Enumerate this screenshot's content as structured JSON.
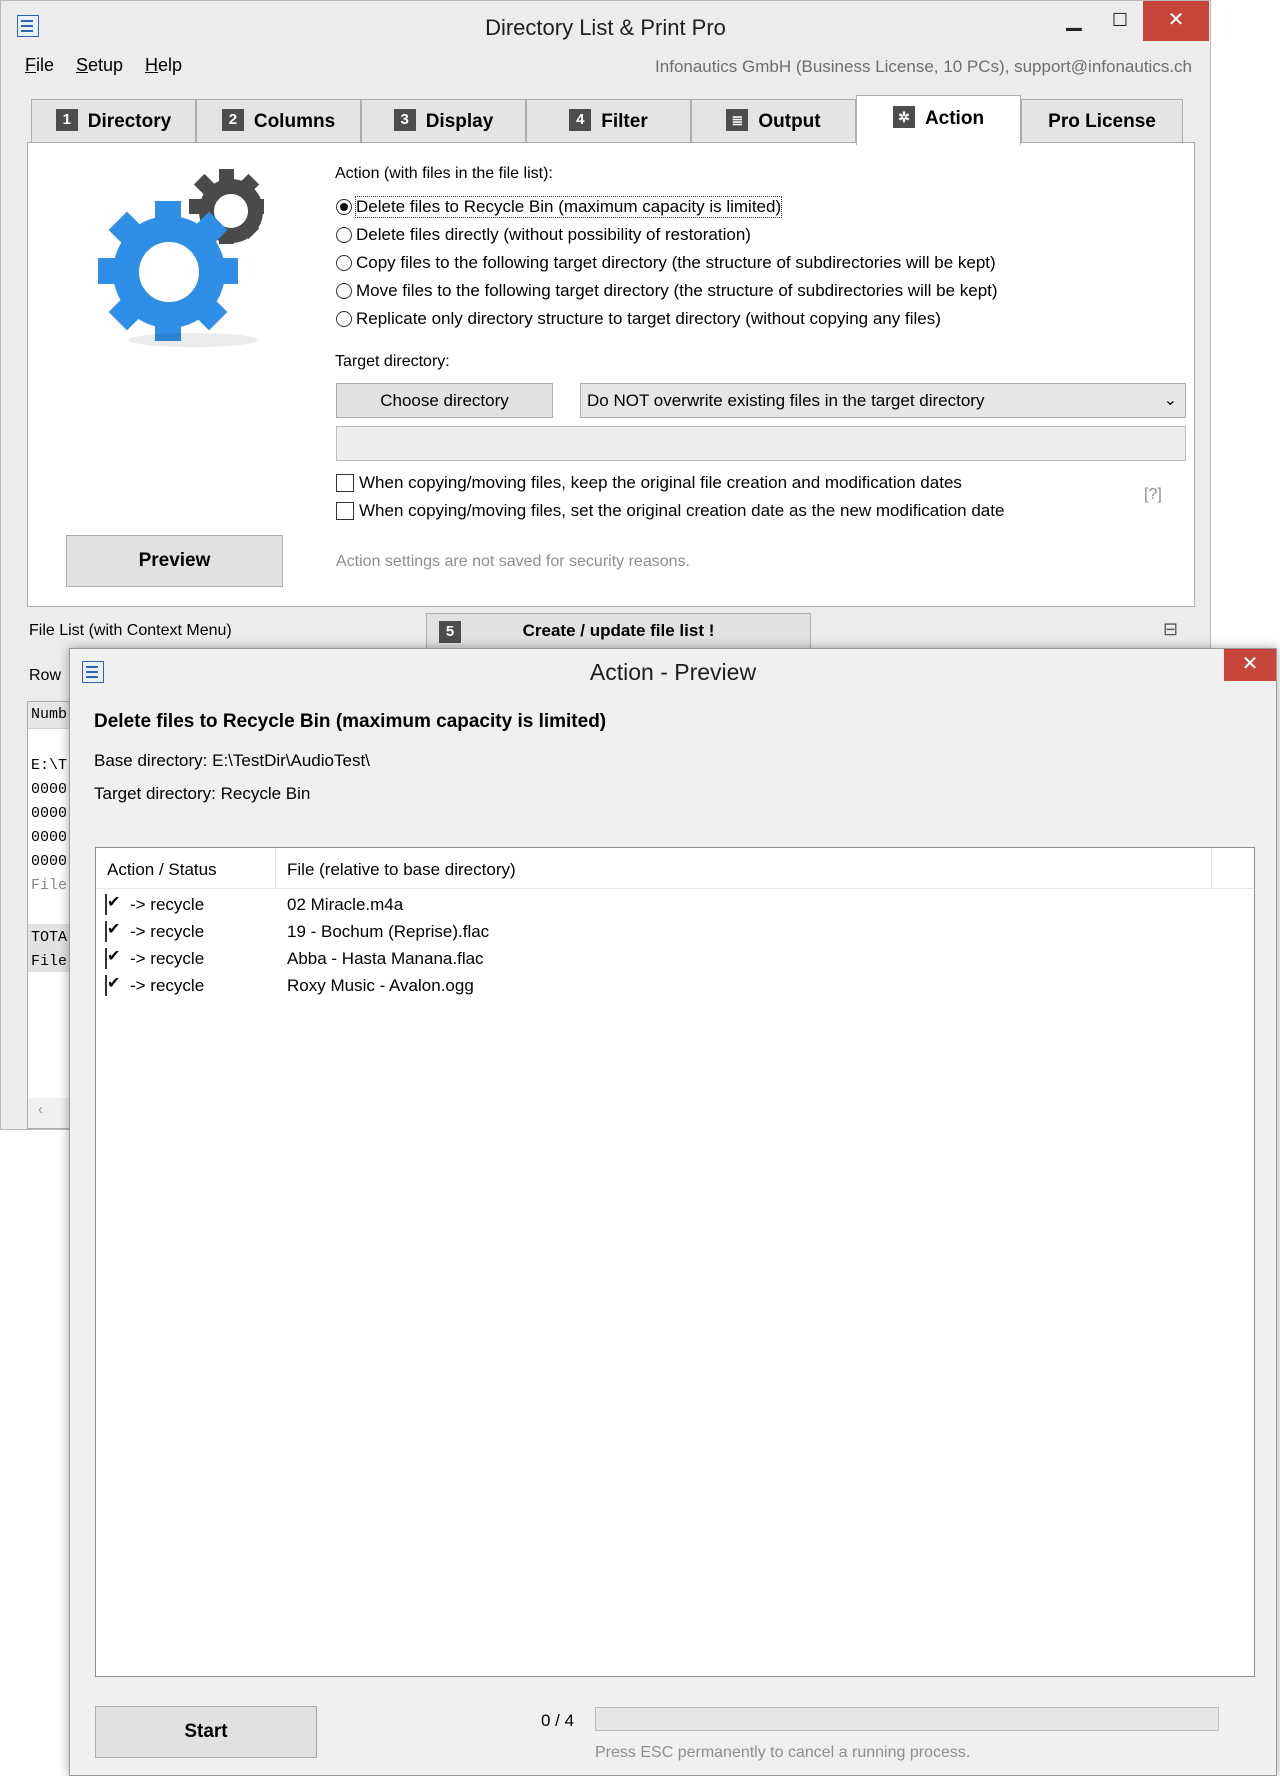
{
  "main_window": {
    "title": "Directory List & Print Pro",
    "menu": [
      {
        "prefix": "F",
        "rest": "ile"
      },
      {
        "prefix": "S",
        "rest": "etup"
      },
      {
        "prefix": "H",
        "rest": "elp"
      }
    ],
    "license_text": "Infonautics GmbH (Business License, 10 PCs), support@infonautics.ch",
    "tabs": [
      {
        "num": "1",
        "label": "Directory"
      },
      {
        "num": "2",
        "label": "Columns"
      },
      {
        "num": "3",
        "label": "Display"
      },
      {
        "num": "4",
        "label": "Filter"
      },
      {
        "icon": "document-icon",
        "label": "Output"
      },
      {
        "icon": "gear-icon",
        "label": "Action",
        "active": true
      },
      {
        "label": "Pro License"
      }
    ]
  },
  "action_tab": {
    "action_label": "Action (with files in the file list):",
    "options": [
      {
        "label": "Delete files to Recycle Bin (maximum capacity is limited)",
        "checked": true
      },
      {
        "label": "Delete files directly (without possibility of restoration)",
        "checked": false
      },
      {
        "label": "Copy files to the following target directory (the structure of subdirectories will be kept)",
        "checked": false
      },
      {
        "label": "Move files to the following target directory (the structure of subdirectories will be kept)",
        "checked": false
      },
      {
        "label": "Replicate only directory structure to target directory (without copying any files)",
        "checked": false
      }
    ],
    "target_label": "Target directory:",
    "choose_button": "Choose directory",
    "overwrite_select": "Do NOT overwrite existing files in the target directory",
    "target_path": "",
    "checkbox_keep_dates": "When copying/moving files, keep the original file creation and modification dates",
    "checkbox_set_creation": "When copying/moving files, set the original creation date as the new modification date",
    "help_link": "[?]",
    "preview_button": "Preview",
    "security_note": "Action settings are not saved for security reasons."
  },
  "bottom_bar": {
    "file_list_label": "File List (with Context Menu)",
    "create_num": "5",
    "create_button": "Create / update file list !",
    "row_label_fragment": "Row"
  },
  "file_list_fragments": [
    "Numb",
    "",
    "E:\\T",
    "0000",
    "0000",
    "0000",
    "0000",
    "File",
    "",
    "TOTA",
    "File"
  ],
  "dialog": {
    "title": "Action - Preview",
    "heading": "Delete files to Recycle Bin (maximum capacity is limited)",
    "base_dir": "Base directory: E:\\TestDir\\AudioTest\\",
    "target_dir": "Target directory: Recycle Bin",
    "columns": [
      "Action / Status",
      "File (relative to base directory)"
    ],
    "rows": [
      {
        "checked": true,
        "status": "-> recycle",
        "file": "02 Miracle.m4a"
      },
      {
        "checked": true,
        "status": "-> recycle",
        "file": "19 - Bochum (Reprise).flac"
      },
      {
        "checked": true,
        "status": "-> recycle",
        "file": "Abba - Hasta Manana.flac"
      },
      {
        "checked": true,
        "status": "-> recycle",
        "file": "Roxy Music - Avalon.ogg"
      }
    ],
    "start_button": "Start",
    "progress_text": "0 / 4",
    "progress_value": 0,
    "esc_hint": "Press ESC permanently to cancel a running process."
  },
  "colors": {
    "gear_blue": "#2f8fe6",
    "gear_dark": "#4a4a4a",
    "close_red": "#c7453b"
  }
}
